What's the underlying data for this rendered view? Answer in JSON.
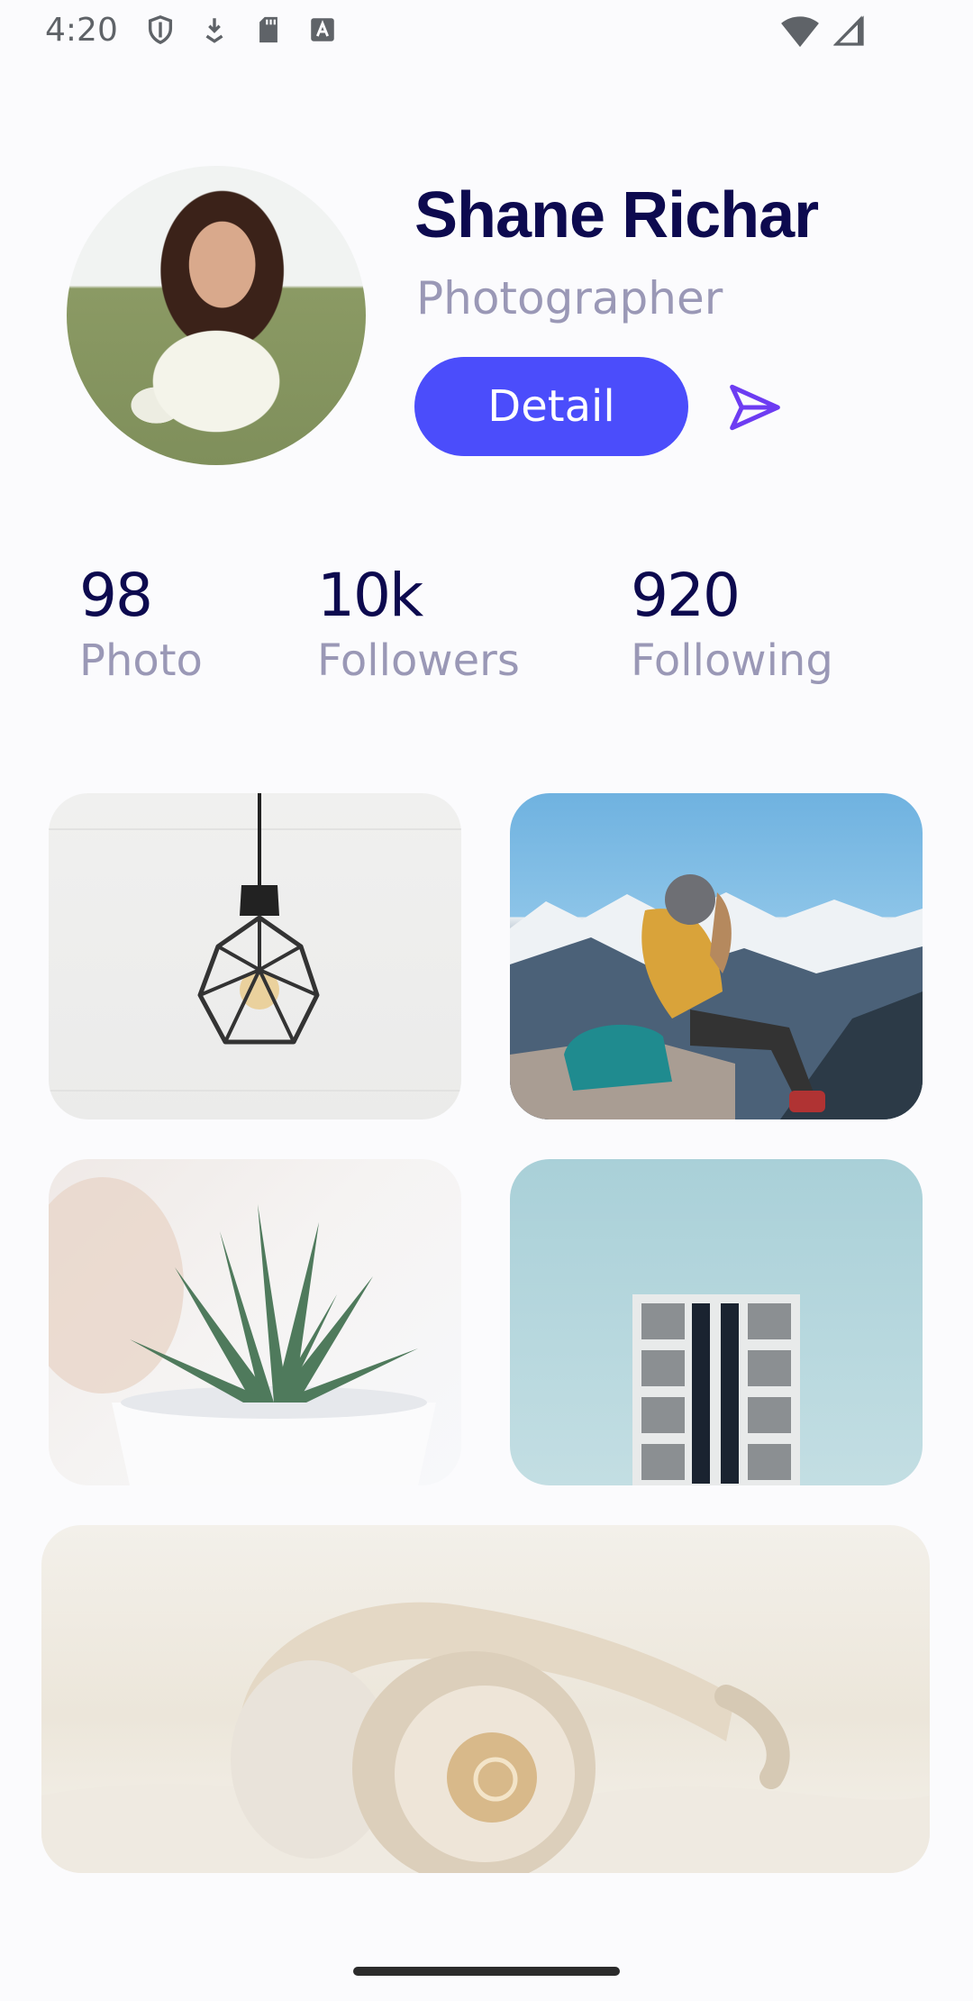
{
  "status_bar": {
    "time": "4:20",
    "left_icons": [
      "shield-icon",
      "download-icon",
      "sd-card-icon",
      "keyboard-a-icon"
    ],
    "right_icons": [
      "wifi-icon",
      "cell-signal-icon"
    ]
  },
  "profile": {
    "name": "Shane Richar",
    "role": "Photographer",
    "detail_label": "Detail",
    "send_icon": "send-icon",
    "accent_color": "#4b4dfb"
  },
  "stats": [
    {
      "value": "98",
      "label": "Photo"
    },
    {
      "value": "10k",
      "label": "Followers"
    },
    {
      "value": "920",
      "label": "Following"
    }
  ],
  "photos": [
    "lamp-photo",
    "hiker-photo",
    "plant-photo",
    "building-photo",
    "headphones-photo"
  ]
}
